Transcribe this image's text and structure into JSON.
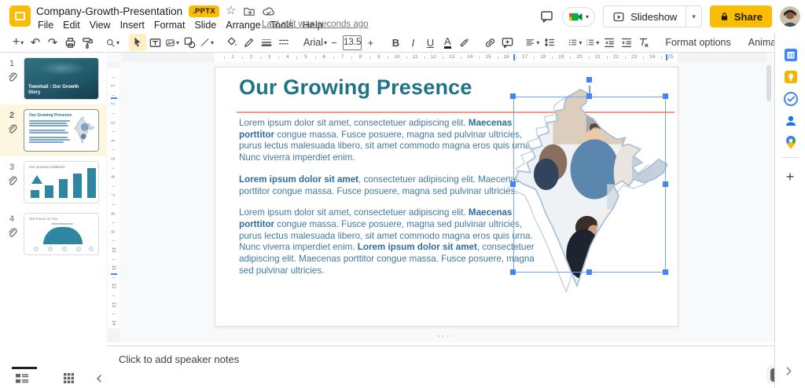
{
  "header": {
    "title": "Company-Growth-Presentation",
    "badge": ".PPTX",
    "menu": [
      "File",
      "Edit",
      "View",
      "Insert",
      "Format",
      "Slide",
      "Arrange",
      "Tools",
      "Help"
    ],
    "last_edit": "Last edit was seconds ago",
    "slideshow_label": "Slideshow",
    "share_label": "Share",
    "icons": [
      "slides-logo",
      "star-icon",
      "move-folder-icon",
      "cloud-check-icon",
      "comments-icon",
      "meet-icon",
      "slideshow-play-icon",
      "lock-icon",
      "avatar"
    ]
  },
  "toolbar": {
    "font_name": "Arial",
    "font_size": "13.5",
    "minus_label": "−",
    "plus_label": "+",
    "bold_label": "B",
    "italic_label": "I",
    "underline_label": "U",
    "text_color_label": "A",
    "format_options_label": "Format options",
    "animate_label": "Animate",
    "icons": [
      "new-slide",
      "undo",
      "redo",
      "print",
      "paint-format",
      "zoom",
      "select-cursor",
      "text-box",
      "insert-image",
      "insert-shape",
      "insert-line",
      "fill-color",
      "border-color",
      "border-weight",
      "border-dash",
      "insert-link",
      "add-comment",
      "align",
      "line-spacing",
      "bulleted-list",
      "numbered-list",
      "decrease-indent",
      "increase-indent",
      "clear-formatting",
      "toolbar-collapse"
    ]
  },
  "filmstrip": {
    "slides": [
      {
        "num": "1",
        "title": "Townhall : Our Growth Story",
        "selected": false
      },
      {
        "num": "2",
        "title": "Our Growing Presence",
        "selected": true
      },
      {
        "num": "3",
        "title": "Our Growing Initiatives",
        "selected": false
      },
      {
        "num": "4",
        "title": "Our Focus on You",
        "selected": false
      }
    ]
  },
  "ruler": {
    "h_numbers": [
      1,
      2,
      3,
      4,
      5,
      6,
      7,
      8,
      9,
      10,
      11,
      12,
      13,
      14,
      15,
      16,
      17,
      18,
      19,
      20,
      21,
      22,
      23,
      24,
      25
    ],
    "v_numbers": [
      1,
      2,
      3,
      4,
      5,
      6,
      7,
      8,
      9,
      10,
      11,
      12,
      13,
      14
    ]
  },
  "slide": {
    "title": "Our Growing Presence",
    "paragraphs": [
      {
        "segments": [
          {
            "t": "Lorem ipsum dolor sit amet, consectetuer adipiscing elit. ",
            "b": false
          },
          {
            "t": "Maecenas porttitor",
            "b": true
          },
          {
            "t": " congue massa. Fusce posuere, magna sed pulvinar ultricies, purus lectus malesuada libero, sit amet commodo magna eros quis urna. Nunc viverra imperdiet enim.",
            "b": false
          }
        ]
      },
      {
        "segments": [
          {
            "t": "Lorem ipsum dolor sit amet",
            "b": true
          },
          {
            "t": ", consectetuer adipiscing elit. Maecenas porttitor congue massa. Fusce posuere, magna sed pulvinar ultricies.",
            "b": false
          }
        ]
      },
      {
        "segments": [
          {
            "t": "Lorem ipsum dolor sit amet, consectetuer adipiscing elit. ",
            "b": false
          },
          {
            "t": "Maecenas porttitor",
            "b": true
          },
          {
            "t": " congue massa. Fusce posuere, magna sed pulvinar ultricies, purus lectus malesuada libero, sit amet commodo magna eros quis urna. Nunc viverra imperdiet enim. ",
            "b": false
          },
          {
            "t": "Lorem ipsum dolor sit amet",
            "b": true
          },
          {
            "t": ", consectetuer adipiscing elit. Maecenas porttitor congue massa. Fusce posuere, magna sed pulvinar ultricies.",
            "b": false
          }
        ]
      }
    ]
  },
  "notes": {
    "placeholder": "Click to add speaker notes"
  },
  "side_panel": {
    "icons": [
      "calendar-icon",
      "keep-icon",
      "tasks-icon",
      "contacts-icon",
      "maps-icon",
      "get-addons-plus",
      "panel-expand-chevron"
    ]
  },
  "bottom_bar": {
    "icons": [
      "filmstrip-view-icon",
      "grid-view-icon",
      "collapse-filmstrip-icon",
      "explore-icon"
    ]
  },
  "colors": {
    "accent_yellow": "#fbbc04",
    "title_teal": "#1e7486",
    "body_blue": "#42799f",
    "divider_red": "#f19a8c",
    "selection_blue": "#4285f4",
    "selected_row": "#fef7e0"
  }
}
